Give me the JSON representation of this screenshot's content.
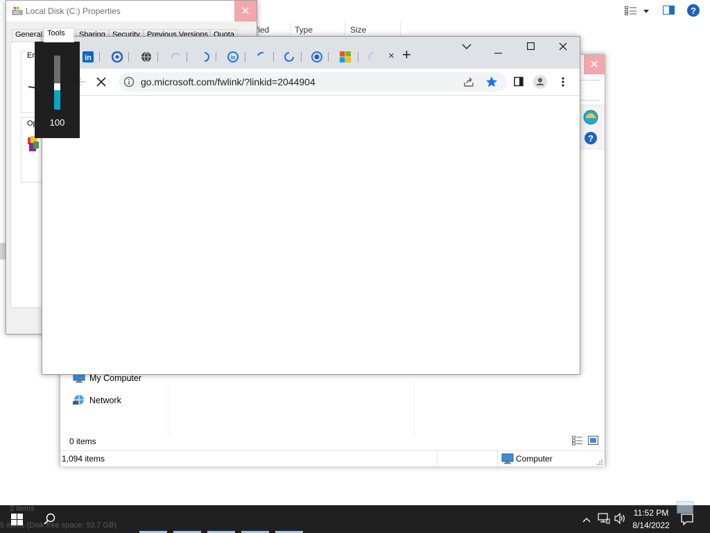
{
  "background_explorer": {
    "columns": [
      "fied",
      "Type",
      "Size"
    ]
  },
  "properties_dialog": {
    "title": "Local Disk (C:) Properties",
    "close_glyph": "✕",
    "tabs": [
      "General",
      "Tools",
      "Sharing",
      "Security",
      "Previous Versions",
      "Quota"
    ],
    "active_tab": "Tools",
    "group1_label": "Err",
    "group2_label": "Opt"
  },
  "volume_osd": {
    "level": 100,
    "level_label": "100"
  },
  "browser": {
    "url": "go.microsoft.com/fwlink/?linkid=2044904",
    "new_tab_glyph": "+",
    "tab_close_glyph": "×",
    "window_controls": [
      "chevron-down",
      "minimize",
      "maximize",
      "close"
    ]
  },
  "explorer2": {
    "close_glyph": "✕",
    "nav_items": [
      "My Computer",
      "Network"
    ],
    "folder_status": "0 items",
    "status_items": "1,094 items",
    "status_location": "Computer"
  },
  "taskbar": {
    "time": "11:52 PM",
    "date": "8/14/2022",
    "ghost_text_1": "2 items",
    "ghost_text_2": "5 items (Disk free space: 93.7 GB)"
  },
  "colors": {
    "accent": "#1a73e8",
    "close_red": "#f4a6ad",
    "volume_fill": "#00a8c6",
    "taskbar": "#202020"
  }
}
